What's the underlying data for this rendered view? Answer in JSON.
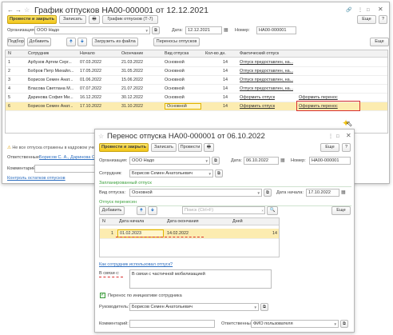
{
  "main": {
    "title": "График отпусков НА00-000001 от 12.12.2021",
    "toolbar": {
      "post_close": "Провести и закрыть",
      "save": "Записать",
      "schedule_btn": "График отпусков (Т-7)",
      "more": "Еще"
    },
    "org_label": "Организация:",
    "org_value": "ООО Надо",
    "date_label": "Дата:",
    "date_value": "12.12.2021",
    "number_label": "Номер:",
    "number_value": "НА00-000001",
    "table_toolbar": {
      "pick": "Подбор",
      "add": "Добавить",
      "load": "Загрузить из файла",
      "transfers": "Переносы отпусков",
      "more": "Еще"
    },
    "columns": [
      "N",
      "Сотрудник",
      "Начало",
      "Окончание",
      "Вид отпуска",
      "Кол-во дн.",
      "Фактический отпуск"
    ],
    "rows": [
      {
        "n": "1",
        "emp": "Арбузов Артем Серг...",
        "start": "07.03.2022",
        "end": "21.03.2022",
        "kind": "Основной",
        "days": "14",
        "fact": "Отпуск предоставлен, на...",
        "tr": ""
      },
      {
        "n": "2",
        "emp": "Бобров Петр Михайл...",
        "start": "17.05.2022",
        "end": "31.05.2022",
        "kind": "Основной",
        "days": "14",
        "fact": "Отпуск предоставлен, на...",
        "tr": ""
      },
      {
        "n": "3",
        "emp": "Борисов Семен Анат...",
        "start": "01.06.2022",
        "end": "15.06.2022",
        "kind": "Основной",
        "days": "14",
        "fact": "Отпуск предоставлен, на...",
        "tr": ""
      },
      {
        "n": "4",
        "emp": "Власова Светлана М...",
        "start": "07.07.2022",
        "end": "21.07.2022",
        "kind": "Основной",
        "days": "14",
        "fact": "Отпуск предоставлен, на...",
        "tr": ""
      },
      {
        "n": "5",
        "emp": "Даринова София Ми...",
        "start": "16.12.2022",
        "end": "30.12.2022",
        "kind": "Основной",
        "days": "14",
        "fact": "Оформить отпуск",
        "tr": "Оформить перенос"
      },
      {
        "n": "6",
        "emp": "Борисов Семен Анат...",
        "start": "17.10.2022",
        "end": "31.10.2022",
        "kind": "Основной",
        "days": "14",
        "fact": "Оформить отпуск",
        "tr": "Оформить перенос"
      }
    ],
    "warning": "Не все отпуска отражены в кадровом уче",
    "responsible_label": "Ответственные:",
    "responsible_value": "Борисов С. А., Даринова С. М.",
    "comment_label": "Комментарий:",
    "balance_link": "Контроль остатков отпусков"
  },
  "dialog": {
    "title": "Перенос отпуска НА00-000001 от 06.10.2022",
    "toolbar": {
      "post_close": "Провести и закрыть",
      "save": "Записать",
      "post": "Провести",
      "more": "Еще"
    },
    "org_label": "Организация:",
    "org_value": "ООО Надо",
    "date_label": "Дата:",
    "date_value": "06.10.2022",
    "number_label": "Номер:",
    "number_value": "НА00-000001",
    "employee_label": "Сотрудник:",
    "employee_value": "Борисов Семен Анатольевич",
    "planned_header": "Запланированный отпуск",
    "kind_label": "Вид отпуска:",
    "kind_value": "Основной",
    "start_label": "Дата начала:",
    "start_value": "17.10.2022",
    "transferred_header": "Отпуск перенесен",
    "add": "Добавить",
    "search_placeholder": "Поиск (Ctrl+F)",
    "more": "Еще",
    "columns": [
      "N",
      "Дата начала",
      "Дата окончания",
      "Дней"
    ],
    "row": {
      "n": "1",
      "start": "01.02.2023",
      "end": "14.02.2022",
      "days": "14"
    },
    "used_link": "Как сотрудник использовал отпуск?",
    "reason_label": "В связи с:",
    "reason_value": "В связи с частичной мобилизацией",
    "initiative_label": "Перенос по инициативе сотрудника",
    "manager_label": "Руководитель:",
    "manager_value": "Борисов Семен Анатольевич",
    "comment_label": "Комментарий:",
    "responsible_label": "Ответственный:",
    "responsible_value": "ФИО пользователя"
  }
}
